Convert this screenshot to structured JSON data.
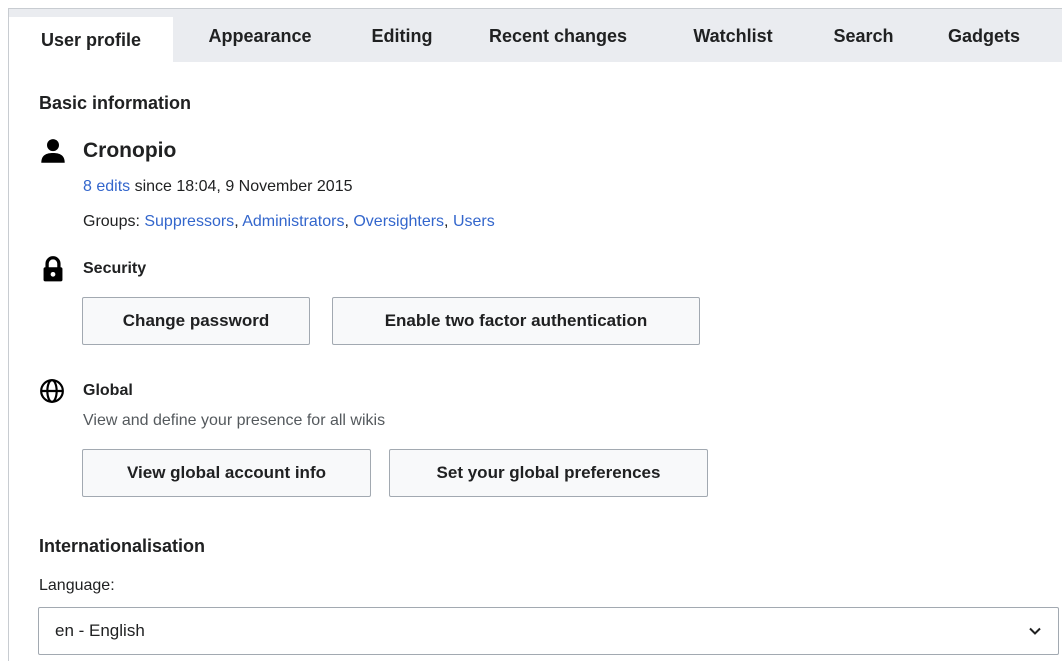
{
  "tabs": [
    {
      "label": "User profile",
      "active": true
    },
    {
      "label": "Appearance",
      "active": false
    },
    {
      "label": "Editing",
      "active": false
    },
    {
      "label": "Recent changes",
      "active": false
    },
    {
      "label": "Watchlist",
      "active": false
    },
    {
      "label": "Search",
      "active": false
    },
    {
      "label": "Gadgets",
      "active": false
    }
  ],
  "basic_info": {
    "heading": "Basic information",
    "user_icon": "user-icon",
    "username": "Cronopio",
    "edits_link": "8 edits",
    "edits_suffix": " since 18:04, 9 November 2015",
    "groups_label": "Groups: ",
    "groups": [
      "Suppressors",
      "Administrators",
      "Oversighters",
      "Users"
    ],
    "group_separator": ", "
  },
  "security": {
    "icon": "lock-icon",
    "heading": "Security",
    "change_password": "Change password",
    "two_factor": "Enable two factor authentication"
  },
  "global": {
    "icon": "globe-icon",
    "heading": "Global",
    "description": "View and define your presence for all wikis",
    "view_account": "View global account info",
    "set_prefs": "Set your global preferences"
  },
  "i18n": {
    "heading": "Internationalisation",
    "language_label": "Language:",
    "language_value": "en - English",
    "chevron_icon": "chevron-down-icon"
  },
  "colors": {
    "link": "#3366cc",
    "tabbar": "#eaecf0",
    "text": "#202122",
    "muted": "#54595d",
    "border": "#a2a9b1",
    "button_bg": "#f8f9fa"
  }
}
